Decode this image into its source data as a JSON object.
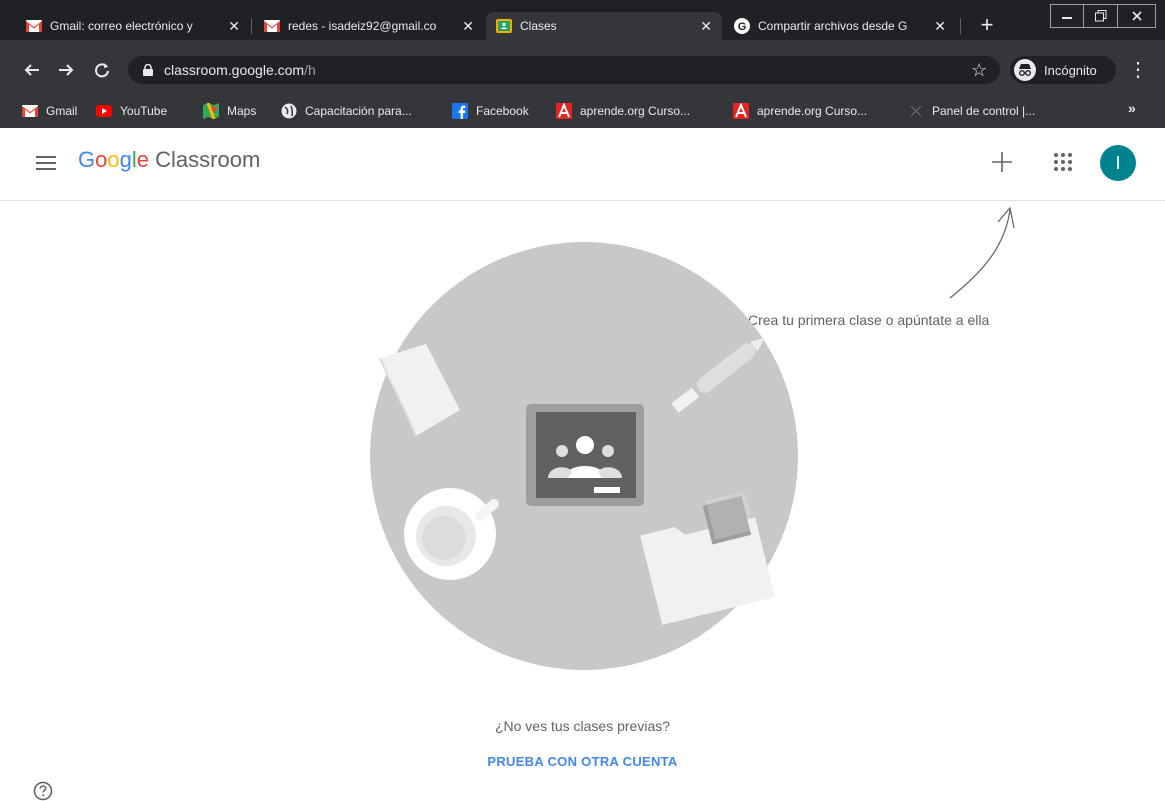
{
  "browser": {
    "tabs": [
      {
        "title": "Gmail: correo electrónico y",
        "active": false,
        "icon": "gmail-icon"
      },
      {
        "title": "redes - isadeiz92@gmail.co",
        "active": false,
        "icon": "gmail-icon"
      },
      {
        "title": "Clases",
        "active": true,
        "icon": "classroom-icon"
      },
      {
        "title": "Compartir archivos desde G",
        "active": false,
        "icon": "google-icon"
      }
    ],
    "close_glyph": "✕",
    "new_tab_glyph": "+",
    "url_host": "classroom.google.com",
    "url_path": "/h",
    "incognito_label": "Incógnito",
    "bookmarks": [
      {
        "label": "Gmail",
        "icon": "gmail-icon"
      },
      {
        "label": "YouTube",
        "icon": "youtube-icon"
      },
      {
        "label": "Maps",
        "icon": "maps-icon"
      },
      {
        "label": "Capacitación para...",
        "icon": "globe-icon"
      },
      {
        "label": "Facebook",
        "icon": "facebook-icon"
      },
      {
        "label": "aprende.org Curso...",
        "icon": "aprende-icon"
      },
      {
        "label": "aprende.org Curso...",
        "icon": "aprende-icon"
      },
      {
        "label": "Panel de control |...",
        "icon": "panel-icon"
      }
    ],
    "more_bookmarks": "»"
  },
  "app": {
    "logo_google": [
      "G",
      "o",
      "o",
      "g",
      "l",
      "e"
    ],
    "logo_product": "Classroom",
    "avatar_initial": "I",
    "hint_text": "Crea tu primera clase o apúntate a ella",
    "no_previous_text": "¿No ves tus clases previas?",
    "try_other_account": "PRUEBA CON OTRA CUENTA"
  },
  "colors": {
    "chrome_dark": "#202124",
    "toolbar": "#35363a",
    "avatar": "#00838f",
    "link_blue": "#4285f4",
    "illustration_gray": "#c8c8c8"
  }
}
